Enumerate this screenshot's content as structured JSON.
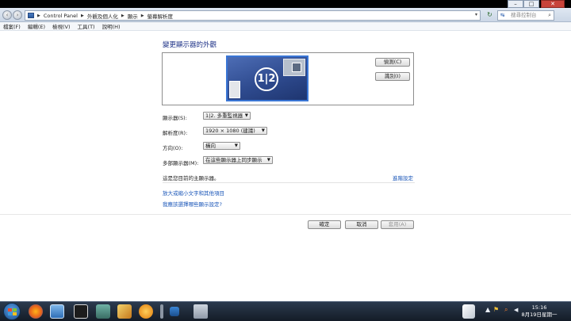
{
  "address_bar": {
    "crumbs": [
      "Control Panel",
      "外觀及個人化",
      "顯示",
      "螢幕解析度"
    ]
  },
  "search": {
    "placeholder": "搜尋控制台"
  },
  "menu": [
    "檔案(F)",
    "編輯(E)",
    "檢視(V)",
    "工具(T)",
    "說明(H)"
  ],
  "page": {
    "title": "變更顯示器的外觀",
    "monitor_id": "1|2",
    "detect_button": "偵測(C)",
    "identify_button": "識別(I)",
    "display_label": "顯示器(S):",
    "display_value": "1|2. 多重監視器",
    "resolution_label": "解析度(R):",
    "resolution_value": "1920 × 1080 (建議)",
    "orientation_label": "方向(O):",
    "orientation_value": "橫向",
    "multi_label": "多部顯示器(M):",
    "multi_value": "在這些顯示器上同步顯示",
    "status": "這是您目前的主顯示器。",
    "advanced_link": "進階設定",
    "link1": "放大或縮小文字和其他項目",
    "link2": "我應該選擇哪些顯示設定?",
    "ok": "確定",
    "cancel": "取消",
    "apply": "套用(A)"
  },
  "taskbar": {
    "time": "15:16",
    "date": "8月19日星期一"
  }
}
